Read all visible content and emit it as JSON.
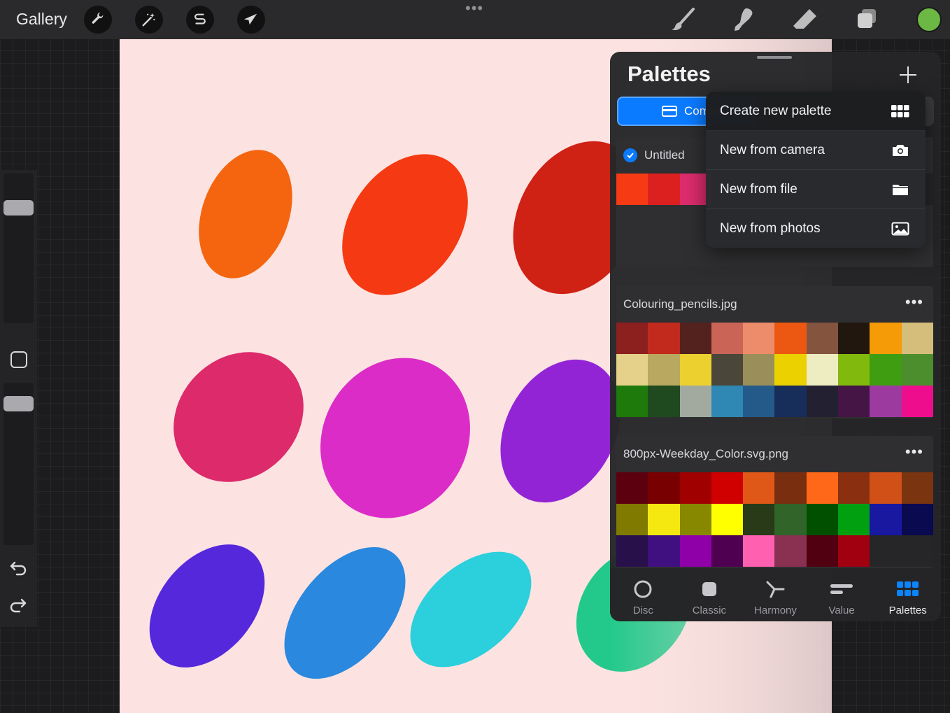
{
  "topbar": {
    "gallery_label": "Gallery",
    "actions": [
      "wrench-icon",
      "magic-wand-icon",
      "selection-s-icon",
      "transform-arrow-icon"
    ],
    "tools": [
      "brush-icon",
      "smudge-icon",
      "eraser-icon",
      "layers-icon"
    ],
    "current_color": "#6bb845"
  },
  "canvas": {
    "background": "#fce3e1",
    "blobs": [
      "#f5650f",
      "#f53912",
      "#cf2114",
      "#dc2a6a",
      "#dc2cc7",
      "#9324d6",
      "#5528dc",
      "#2a88de",
      "#2ccfdc",
      "#22c98a"
    ]
  },
  "palettes": {
    "title": "Palettes",
    "compact_label": "Compact",
    "untitled": {
      "name": "Untitled",
      "is_default": true,
      "colors": [
        "#f53a14",
        "#dc2020",
        "#dc2c6c"
      ]
    },
    "colouring": {
      "name": "Colouring_pencils.jpg",
      "colors": [
        "#8c201e",
        "#c32a1e",
        "#54221e",
        "#c96456",
        "#ec8c6a",
        "#ec5812",
        "#85543e",
        "#22170f",
        "#f59b08",
        "#d5bd7b",
        "#e5d18a",
        "#b9a85f",
        "#ebd02f",
        "#4a463a",
        "#9a8f5a",
        "#ebd100",
        "#eeecc1",
        "#82b90d",
        "#3e9d10",
        "#4c8e2d",
        "#1e7a0a",
        "#1f4a1f",
        "#a2aaa0",
        "#2f88b3",
        "#245a8a",
        "#172d5a",
        "#222031",
        "#451546",
        "#9c3aa0",
        "#ee0e8d"
      ]
    },
    "weekday": {
      "name": "800px-Weekday_Color.svg.png",
      "colors": [
        "#5c0010",
        "#780000",
        "#a00000",
        "#d00000",
        "#e05818",
        "#7a2e10",
        "#ff6818",
        "#8a3010",
        "#d05018",
        "#7a3410",
        "#807a00",
        "#f4e810",
        "#888800",
        "#ffff00",
        "#283a18",
        "#306428",
        "#005000",
        "#00a010",
        "#1818a0",
        "#0a0a50",
        "#28104a",
        "#401080",
        "#9000a8",
        "#500050",
        "#ff60b0",
        "#8a3050",
        "#500010",
        "#a00010",
        null,
        null
      ]
    },
    "menu": {
      "create_new": "Create new palette",
      "from_camera": "New from camera",
      "from_file": "New from file",
      "from_photos": "New from photos"
    },
    "tabs": {
      "disc": "Disc",
      "classic": "Classic",
      "harmony": "Harmony",
      "value": "Value",
      "palettes": "Palettes",
      "active": "Palettes"
    }
  }
}
